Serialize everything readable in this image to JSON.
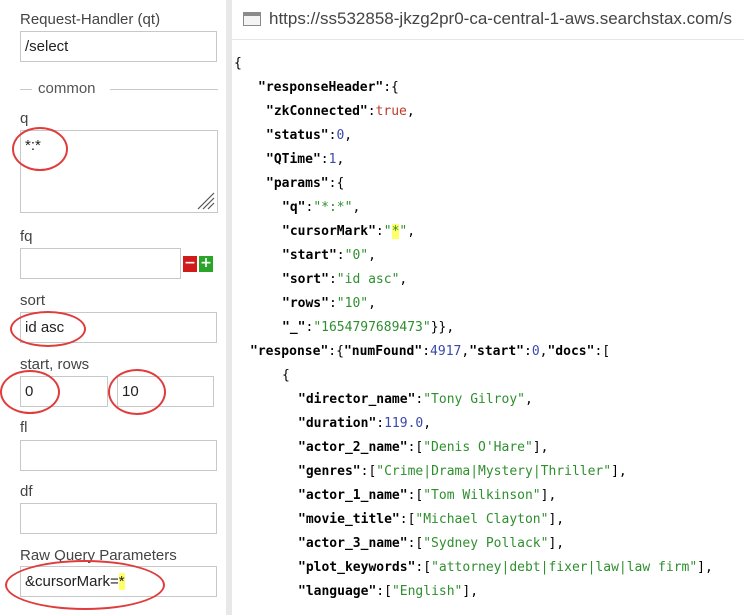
{
  "form": {
    "request_handler_label": "Request-Handler (qt)",
    "request_handler_value": "/select",
    "common_legend": "common",
    "q_label": "q",
    "q_value": "*:*",
    "fq_label": "fq",
    "fq_value": "",
    "remove_symbol": "−",
    "add_symbol": "+",
    "sort_label": "sort",
    "sort_value": "id asc",
    "start_rows_label": "start, rows",
    "start_value": "0",
    "rows_value": "10",
    "fl_label": "fl",
    "fl_value": "",
    "df_label": "df",
    "df_value": "",
    "raw_label": "Raw Query Parameters",
    "raw_prefix": "&cursorMark=",
    "raw_highlight": "*"
  },
  "url": {
    "text": "https://ss532858-jkzg2pr0-ca-central-1-aws.searchstax.com/s",
    "icon": "page-icon"
  },
  "json_view": {
    "open_brace": "{",
    "response_header_key": "\"responseHeader\"",
    "zk_key": "\"zkConnected\"",
    "zk_val": "true",
    "status_key": "\"status\"",
    "status_val": "0",
    "qtime_key": "\"QTime\"",
    "qtime_val": "1",
    "params_key": "\"params\"",
    "q_key": "\"q\"",
    "q_val": "\"*:*\"",
    "cursor_key": "\"cursorMark\"",
    "cursor_q1": "\"",
    "cursor_star": "*",
    "cursor_q2": "\"",
    "start_key": "\"start\"",
    "start_val": "\"0\"",
    "sort_key": "\"sort\"",
    "sort_val": "\"id asc\"",
    "rows_key": "\"rows\"",
    "rows_val": "\"10\"",
    "underscore_key": "\"_\"",
    "underscore_val": "\"1654797689473\"",
    "params_close": "}},",
    "response_key": "\"response\"",
    "numfound_key": "\"numFound\"",
    "numfound_val": "4917",
    "resp_start_key": "\"start\"",
    "resp_start_val": "0",
    "docs_key": "\"docs\"",
    "docs_open": "[",
    "doc_open": "{",
    "director_key": "\"director_name\"",
    "director_val": "\"Tony Gilroy\"",
    "duration_key": "\"duration\"",
    "duration_val": "119.0",
    "actor2_key": "\"actor_2_name\"",
    "actor2_val": "\"Denis O'Hare\"",
    "genres_key": "\"genres\"",
    "genres_val": "\"Crime|Drama|Mystery|Thriller\"",
    "actor1_key": "\"actor_1_name\"",
    "actor1_val": "\"Tom Wilkinson\"",
    "title_key": "\"movie_title\"",
    "title_val": "\"Michael Clayton\"",
    "actor3_key": "\"actor_3_name\"",
    "actor3_val": "\"Sydney Pollack\"",
    "plot_key": "\"plot_keywords\"",
    "plot_val": "\"attorney|debt|fixer|law|law firm\"",
    "language_key": "\"language\"",
    "language_val": "\"English\""
  },
  "colors": {
    "annotation": "#e03c3c",
    "highlight": "#ffff66",
    "json_string": "#2f8f2f",
    "json_number": "#3949ab",
    "json_boolean": "#c0392b"
  }
}
